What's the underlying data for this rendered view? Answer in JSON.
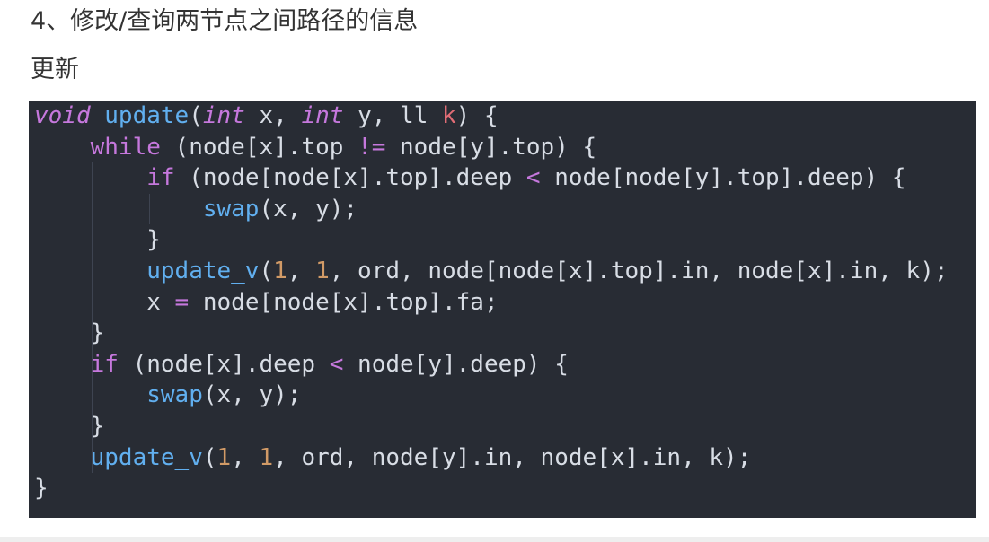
{
  "article": {
    "heading": "4、修改/查询两节点之间路径的信息",
    "subheading": "更新"
  },
  "code": {
    "language": "cpp",
    "lines": [
      [
        {
          "t": "void",
          "c": "t-kw-i"
        },
        {
          "t": " ",
          "c": "t-plain"
        },
        {
          "t": "update",
          "c": "t-fn"
        },
        {
          "t": "(",
          "c": "t-plain"
        },
        {
          "t": "int",
          "c": "t-kw-i"
        },
        {
          "t": " x, ",
          "c": "t-plain"
        },
        {
          "t": "int",
          "c": "t-kw-i"
        },
        {
          "t": " y, ",
          "c": "t-plain"
        },
        {
          "t": "ll",
          "c": "t-plain"
        },
        {
          "t": " ",
          "c": "t-plain"
        },
        {
          "t": "k",
          "c": "t-param"
        },
        {
          "t": ") {",
          "c": "t-plain"
        }
      ],
      [
        {
          "t": "    ",
          "c": "t-plain"
        },
        {
          "t": "while",
          "c": "t-kw"
        },
        {
          "t": " (node[x].top ",
          "c": "t-plain"
        },
        {
          "t": "!=",
          "c": "t-op"
        },
        {
          "t": " node[y].top) {",
          "c": "t-plain"
        }
      ],
      [
        {
          "t": "        ",
          "c": "t-plain"
        },
        {
          "t": "if",
          "c": "t-kw"
        },
        {
          "t": " (node[node[x].top].deep ",
          "c": "t-plain"
        },
        {
          "t": "<",
          "c": "t-op"
        },
        {
          "t": " node[node[y].top].deep) {",
          "c": "t-plain"
        }
      ],
      [
        {
          "t": "            ",
          "c": "t-plain"
        },
        {
          "t": "swap",
          "c": "t-fn"
        },
        {
          "t": "(x, y);",
          "c": "t-plain"
        }
      ],
      [
        {
          "t": "        }",
          "c": "t-plain"
        }
      ],
      [
        {
          "t": "        ",
          "c": "t-plain"
        },
        {
          "t": "update_v",
          "c": "t-fn"
        },
        {
          "t": "(",
          "c": "t-plain"
        },
        {
          "t": "1",
          "c": "t-num"
        },
        {
          "t": ", ",
          "c": "t-plain"
        },
        {
          "t": "1",
          "c": "t-num"
        },
        {
          "t": ", ord, node[node[x].top].in, node[x].in, k);",
          "c": "t-plain"
        }
      ],
      [
        {
          "t": "        x ",
          "c": "t-plain"
        },
        {
          "t": "=",
          "c": "t-op"
        },
        {
          "t": " node[node[x].top].fa;",
          "c": "t-plain"
        }
      ],
      [
        {
          "t": "    }",
          "c": "t-plain"
        }
      ],
      [
        {
          "t": "    ",
          "c": "t-plain"
        },
        {
          "t": "if",
          "c": "t-kw"
        },
        {
          "t": " (node[x].deep ",
          "c": "t-plain"
        },
        {
          "t": "<",
          "c": "t-op"
        },
        {
          "t": " node[y].deep) {",
          "c": "t-plain"
        }
      ],
      [
        {
          "t": "        ",
          "c": "t-plain"
        },
        {
          "t": "swap",
          "c": "t-fn"
        },
        {
          "t": "(x, y);",
          "c": "t-plain"
        }
      ],
      [
        {
          "t": "    }",
          "c": "t-plain"
        }
      ],
      [
        {
          "t": "    ",
          "c": "t-plain"
        },
        {
          "t": "update_v",
          "c": "t-fn"
        },
        {
          "t": "(",
          "c": "t-plain"
        },
        {
          "t": "1",
          "c": "t-num"
        },
        {
          "t": ", ",
          "c": "t-plain"
        },
        {
          "t": "1",
          "c": "t-num"
        },
        {
          "t": ", ord, node[y].in, node[x].in, k);",
          "c": "t-plain"
        }
      ],
      [
        {
          "t": "}",
          "c": "t-plain"
        }
      ]
    ]
  },
  "colors": {
    "code_background": "#282c34",
    "keyword": "#c678dd",
    "function": "#61afef",
    "number": "#d19a66",
    "parameter": "#e06c75",
    "text": "#d8dde5"
  }
}
